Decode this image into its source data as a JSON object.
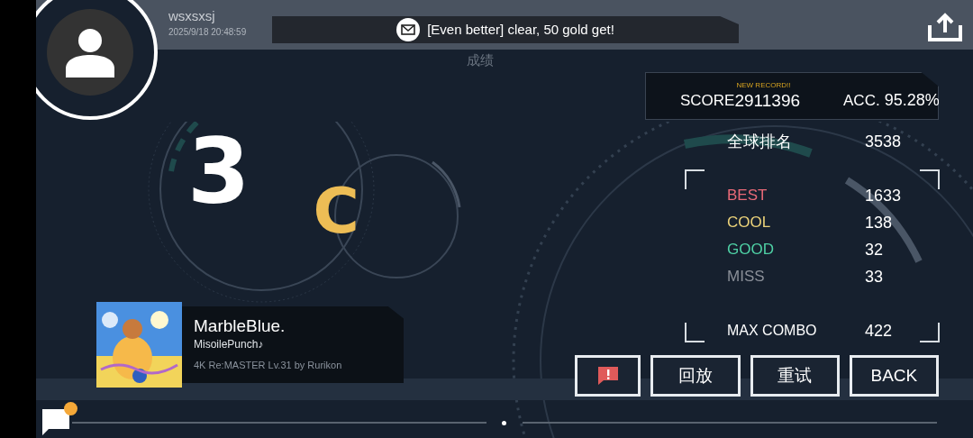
{
  "player": {
    "name": "wsxsxsj",
    "time": "2025/9/18 20:48:59"
  },
  "page_title": "成绩",
  "notice": {
    "text": "[Even better] clear, 50 gold get!"
  },
  "grade": {
    "main": "3",
    "sub": "C"
  },
  "score": {
    "label": "SCORE",
    "value": "2911396",
    "new_record": "NEW RECORD!!",
    "acc_label": "ACC.",
    "acc": "95.28%"
  },
  "rank": {
    "label": "全球排名",
    "value": "3538"
  },
  "judgements": [
    {
      "label": "BEST",
      "value": "1633",
      "color": "#e86a78"
    },
    {
      "label": "COOL",
      "value": "138",
      "color": "#ecd37a"
    },
    {
      "label": "GOOD",
      "value": "32",
      "color": "#4fd1a5"
    },
    {
      "label": "MISS",
      "value": "33",
      "color": "#8a8f98"
    }
  ],
  "max_combo": {
    "label": "MAX COMBO",
    "value": "422"
  },
  "song": {
    "title": "MarbleBlue.",
    "artist": "MisoilePunch♪",
    "chart": "4K Re:MASTER Lv.31 by Rurikon"
  },
  "buttons": [
    {
      "kind": "report"
    },
    {
      "kind": "text",
      "label": "回放"
    },
    {
      "kind": "text",
      "label": "重试"
    },
    {
      "kind": "text",
      "label": "BACK"
    }
  ],
  "chat": {
    "unread": true
  }
}
